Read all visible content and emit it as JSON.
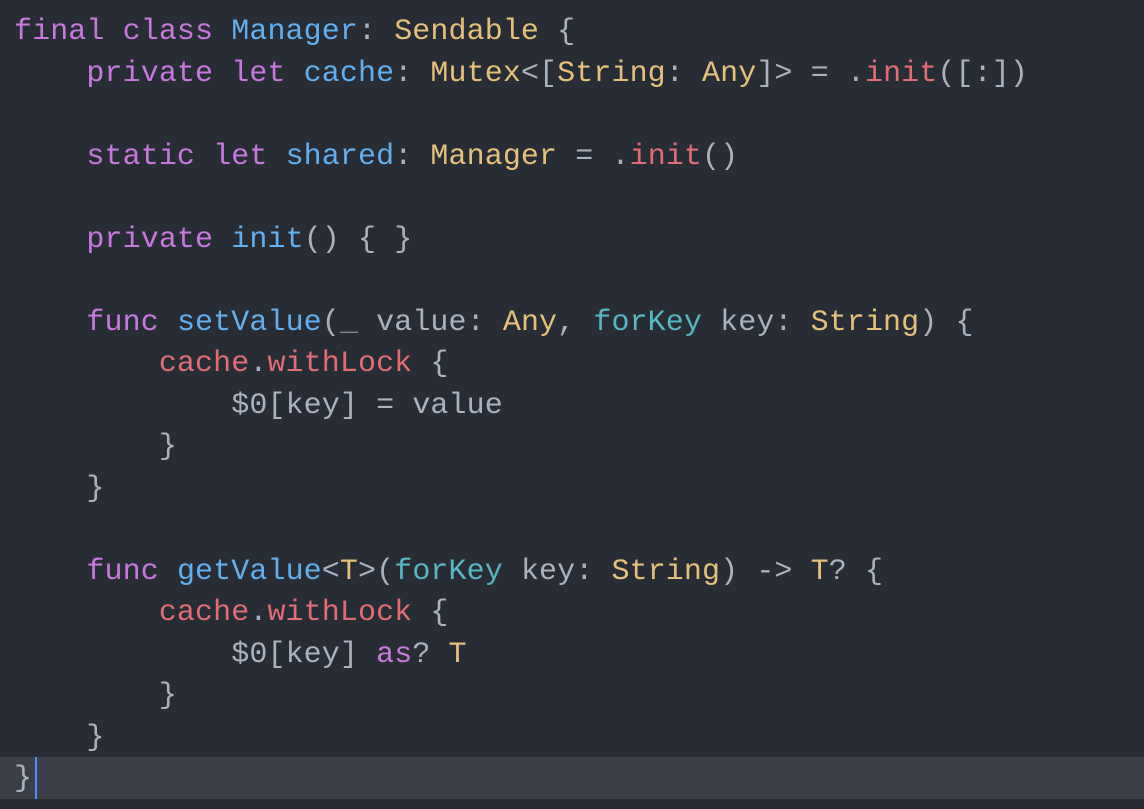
{
  "colors": {
    "background": "#282c34",
    "default": "#abb2bf",
    "keyword": "#c678dd",
    "type": "#e5c07b",
    "identifier_decl": "#61afef",
    "identifier_ref": "#e06c75",
    "label": "#56b6c2",
    "current_line": "#3b4048",
    "cursor": "#528bff"
  },
  "code": {
    "line1": {
      "kw_final": "final",
      "sp": " ",
      "kw_class": "class",
      "type_manager": "Manager",
      "colon": ":",
      "type_sendable": "Sendable",
      "brace_o": "{"
    },
    "line2": {
      "kw_private": "private",
      "kw_let": "let",
      "name_cache": "cache",
      "colon": ":",
      "type_mutex": "Mutex",
      "lt": "<",
      "brk_o": "[",
      "type_string": "String",
      "colon2": ":",
      "type_any": "Any",
      "brk_c": "]",
      "gt": ">",
      "eq": "=",
      "dot": ".",
      "call_init": "init",
      "po": "(",
      "brk_o2": "[",
      "colon3": ":",
      "brk_c2": "]",
      "pc": ")"
    },
    "line4": {
      "kw_static": "static",
      "kw_let": "let",
      "name_shared": "shared",
      "colon": ":",
      "type_manager": "Manager",
      "eq": "=",
      "dot": ".",
      "call_init": "init",
      "po": "(",
      "pc": ")"
    },
    "line6": {
      "kw_private": "private",
      "name_init": "init",
      "po": "(",
      "pc": ")",
      "brace_o": "{",
      "brace_c": "}"
    },
    "line8": {
      "kw_func": "func",
      "name_setValue": "setValue",
      "po": "(",
      "underscore": "_",
      "param_value": "value",
      "colon": ":",
      "type_any": "Any",
      "comma": ",",
      "lbl_forKey": "forKey",
      "param_key": "key",
      "colon2": ":",
      "type_string": "String",
      "pc": ")",
      "brace_o": "{"
    },
    "line9": {
      "ref_cache": "cache",
      "dot": ".",
      "m_withLock": "withLock",
      "brace_o": "{"
    },
    "line10": {
      "dollar0": "$0",
      "brk_o": "[",
      "ref_key": "key",
      "brk_c": "]",
      "eq": "=",
      "ref_value": "value"
    },
    "line11": {
      "brace_c": "}"
    },
    "line12": {
      "brace_c": "}"
    },
    "line14": {
      "kw_func": "func",
      "name_getValue": "getValue",
      "lt": "<",
      "type_T": "T",
      "gt": ">",
      "po": "(",
      "lbl_forKey": "forKey",
      "param_key": "key",
      "colon": ":",
      "type_string": "String",
      "pc": ")",
      "arrow": "->",
      "type_T2": "T",
      "q": "?",
      "brace_o": "{"
    },
    "line15": {
      "ref_cache": "cache",
      "dot": ".",
      "m_withLock": "withLock",
      "brace_o": "{"
    },
    "line16": {
      "dollar0": "$0",
      "brk_o": "[",
      "ref_key": "key",
      "brk_c": "]",
      "kw_as": "as",
      "q": "?",
      "type_T": "T"
    },
    "line17": {
      "brace_c": "}"
    },
    "line18": {
      "brace_c": "}"
    },
    "line19": {
      "brace_c": "}"
    }
  }
}
